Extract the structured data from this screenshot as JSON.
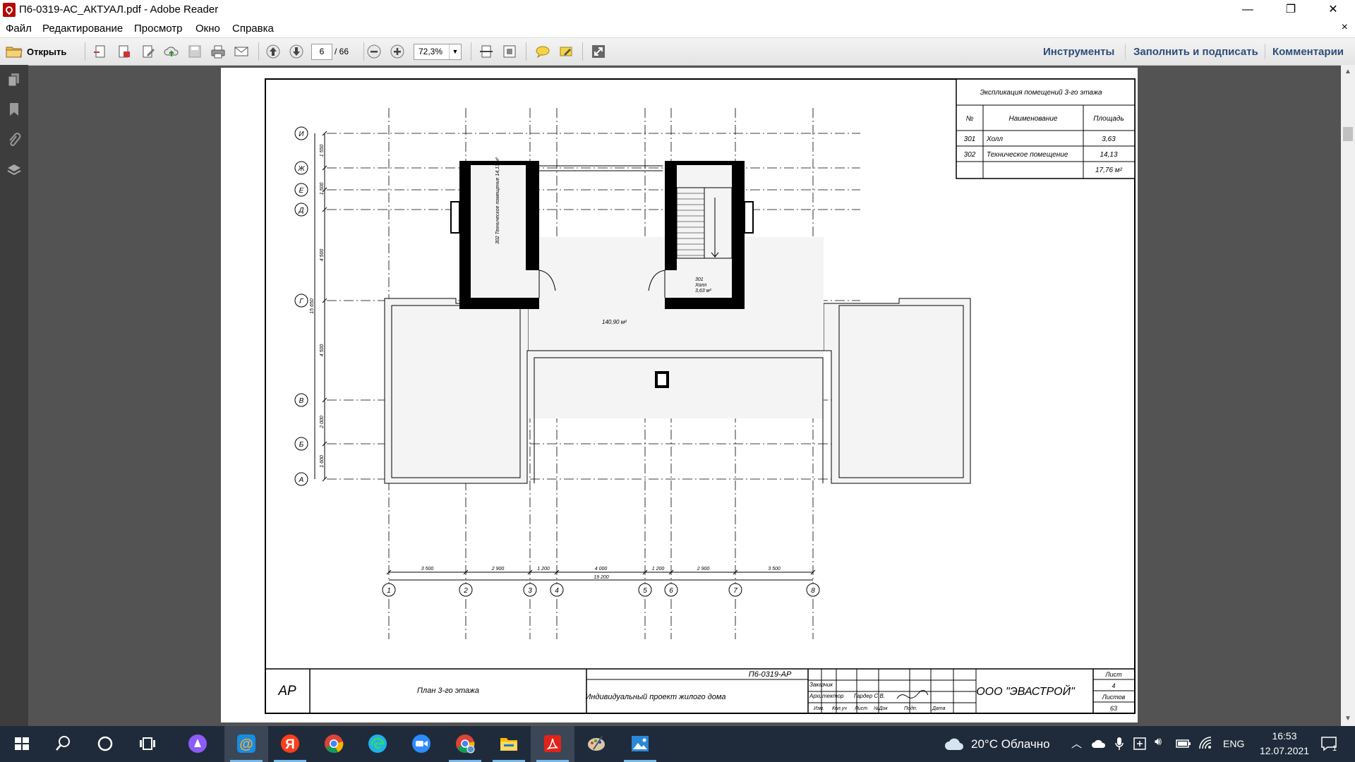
{
  "window": {
    "title": "П6-0319-АС_АКТУАЛ.pdf - Adobe Reader",
    "minimize": "—",
    "maximize": "❐",
    "close": "✕"
  },
  "menu": {
    "items": [
      "Файл",
      "Редактирование",
      "Просмотр",
      "Окно",
      "Справка"
    ],
    "close_doc": "×"
  },
  "toolbar": {
    "open_label": "Открыть",
    "page_current": "6",
    "page_total": "/ 66",
    "zoom": "72,3%",
    "tools": "Инструменты",
    "fill_sign": "Заполнить и подписать",
    "comments": "Комментарии"
  },
  "drawing": {
    "explication": {
      "title": "Экспликация помещений 3-го этажа",
      "headers": [
        "№",
        "Наименование",
        "Площадь"
      ],
      "rows": [
        {
          "num": "301",
          "name": "Холл",
          "area": "3,63"
        },
        {
          "num": "302",
          "name": "Техническое помещение",
          "area": "14,13"
        }
      ],
      "total": "17,76 м²"
    },
    "row_axes": [
      "И",
      "Ж",
      "Е",
      "Д",
      "Г",
      "В",
      "Б",
      "А"
    ],
    "col_axes": [
      "1",
      "2",
      "3",
      "4",
      "5",
      "6",
      "7",
      "8"
    ],
    "col_dims": [
      "3 500",
      "2 900",
      "1 200",
      "4 000",
      "1 200",
      "2 900",
      "3 500"
    ],
    "col_total": "19 200",
    "row_dims": [
      "1 550",
      "1 500",
      "4 500",
      "4 500",
      "2 000",
      "1 600"
    ],
    "row_total": "15 650",
    "room_301": "301\nХолл\n3,63 м²",
    "room_302": "302 Техническое помещение 14,13 м²",
    "roof_area": "140,90 м²",
    "stamp": {
      "mark": "АР",
      "sheet_title": "План 3-го этажа",
      "code": "П6-0319-АР",
      "project": "Индивидуальный проект жилого дома",
      "company": "ООО \"ЭВАСТРОЙ\"",
      "customer": "Заказчик",
      "architect": "Архитектор",
      "architect_name": "Гардер С.В.",
      "cols": [
        "Изм.",
        "Кол.уч",
        "Лист",
        "№Док",
        "Подп.",
        "Дата"
      ],
      "sheet_label": "Лист",
      "sheet_num": "4",
      "sheets_label": "Листов",
      "sheets_num": "63"
    }
  },
  "taskbar": {
    "weather": "20°C  Облачно",
    "lang": "ENG",
    "time": "16:53",
    "date": "12.07.2021",
    "notif_count": "1"
  }
}
